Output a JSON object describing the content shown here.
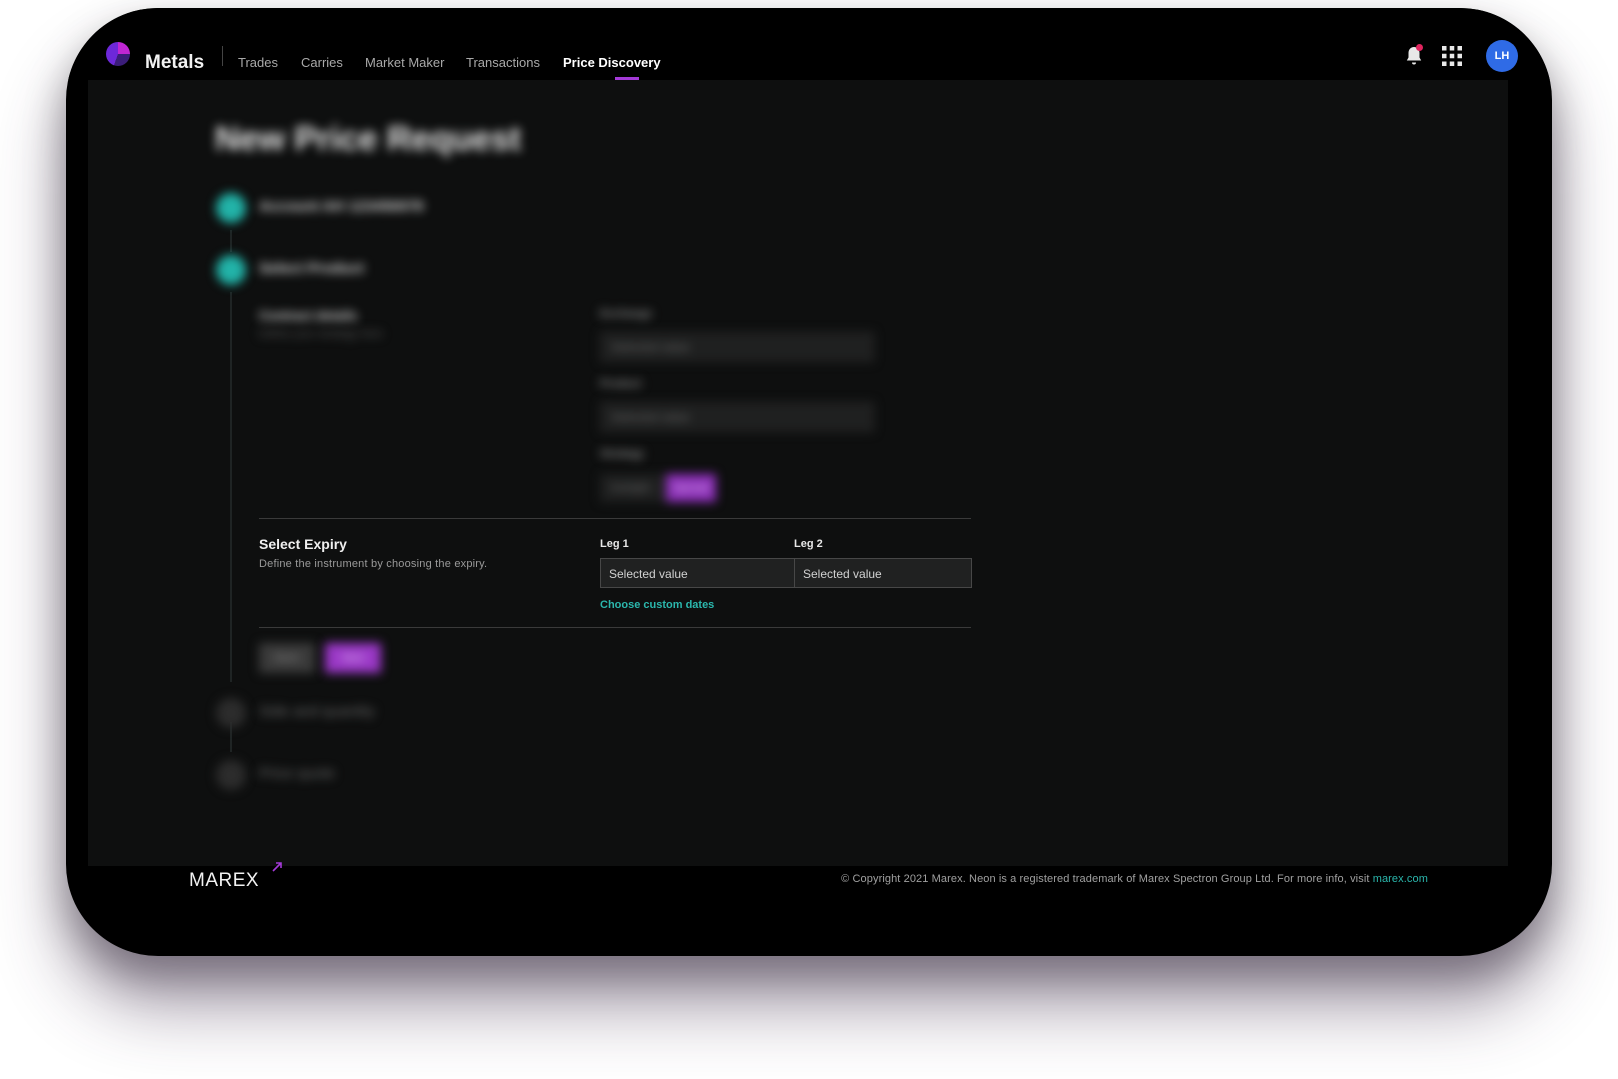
{
  "app": {
    "name": "Metals",
    "user_initials": "LH"
  },
  "nav": {
    "items": [
      {
        "label": "Trades"
      },
      {
        "label": "Carries"
      },
      {
        "label": "Market Maker"
      },
      {
        "label": "Transactions"
      },
      {
        "label": "Price Discovery",
        "active": true
      }
    ]
  },
  "icons": {
    "notifications": "bell-icon",
    "apps": "grid-icon"
  },
  "colors": {
    "accent_purple": "#a43ad8",
    "teal": "#2bb7ad",
    "avatar_blue": "#2f6be6"
  },
  "page": {
    "title": "New Price Request",
    "steps": [
      {
        "label": "Account AH 123456978",
        "state": "done"
      },
      {
        "label": "Select Product",
        "state": "done"
      },
      {
        "label": "Side and quantity",
        "state": "todo"
      },
      {
        "label": "Price quote",
        "state": "todo"
      }
    ],
    "contract": {
      "title": "Contract details",
      "desc": "Define your strategy here",
      "exchange_label": "Exchange",
      "exchange_value": "Selected value",
      "product_label": "Product",
      "product_value": "Selected value",
      "strategy_label": "Strategy",
      "strategy_options": [
        "Outright",
        "Spread"
      ]
    },
    "expiry": {
      "title": "Select Expiry",
      "desc": "Define the instrument by choosing the expiry.",
      "leg1_label": "Leg 1",
      "leg1_value": "Selected value",
      "leg2_label": "Leg 2",
      "leg2_value": "Selected value",
      "custom_link": "Choose custom dates"
    },
    "buttons": {
      "back": "Back",
      "next": "Next"
    }
  },
  "footer": {
    "logo_text": "MAREX",
    "copyright": "© Copyright 2021 Marex. Neon is a registered trademark of Marex Spectron Group Ltd. For more info, visit ",
    "link_text": "marex.com"
  }
}
